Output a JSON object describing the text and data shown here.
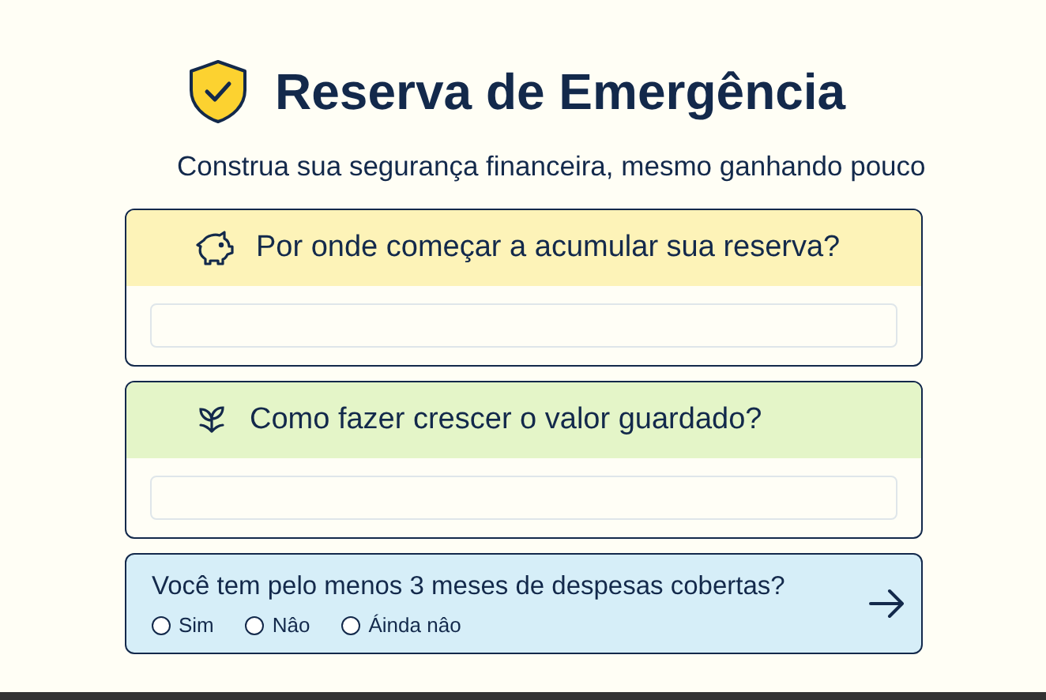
{
  "title": "Reserva de Emergência",
  "subtitle": "Construa sua segurança financeira, mesmo ganhando pouco",
  "cards": [
    {
      "kind": "question",
      "color": "#fdf3b8",
      "title": "Por onde começar a acumular sua reserva?"
    },
    {
      "kind": "question",
      "color": "#e4f5c8",
      "title": "Como fazer crescer o valor guardado?"
    },
    {
      "kind": "quiz",
      "color": "#d6eef8",
      "title": "Você tem pelo menos 3 meses de despesas cobertas?",
      "options": [
        {
          "label": "Sim",
          "selected": false
        },
        {
          "label": "Nâo",
          "selected": false
        },
        {
          "label": "Áinda nâo",
          "selected": false
        }
      ]
    }
  ]
}
